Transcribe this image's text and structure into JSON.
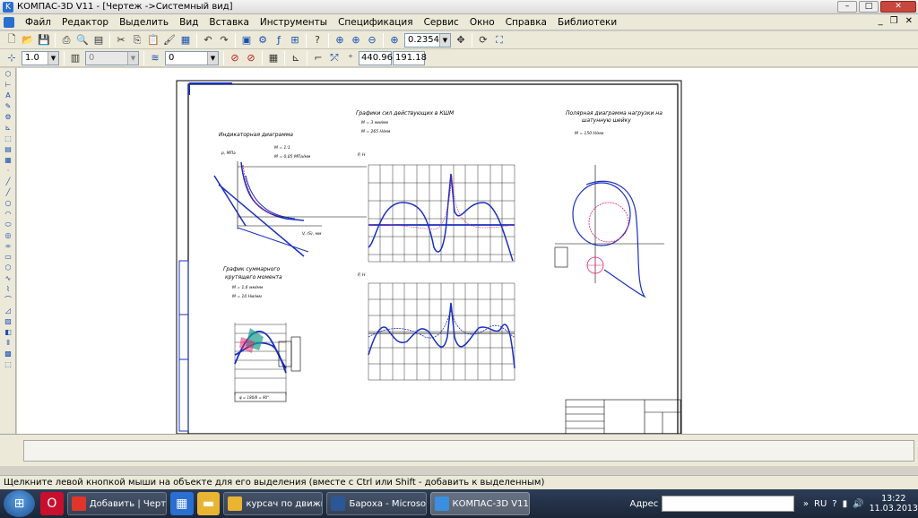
{
  "window": {
    "title": "КОМПАС-3D V11 - [Чертеж ->Системный вид]"
  },
  "menu": [
    "Файл",
    "Редактор",
    "Выделить",
    "Вид",
    "Вставка",
    "Инструменты",
    "Спецификация",
    "Сервис",
    "Окно",
    "Справка",
    "Библиотеки"
  ],
  "toolbar": {
    "zoom": "0.2354",
    "line_scale": "1.0",
    "layer_disabled": "0",
    "view": "0",
    "coord_x": "440.96",
    "coord_y": "191.18"
  },
  "drawing": {
    "indicator_title": "Индикаторная диаграмма",
    "indicator_p": "p, МПа",
    "indicator_m1": "M  = 1:1",
    "indicator_m2": "M  = 0,05 МПа/мм",
    "indicator_v": "V, (S), мм",
    "forces_title": "Графики сил  действующих в КШМ",
    "forces_m1": "M  = 3 мм/мм",
    "forces_m2": "M  = 265 Н/мм",
    "forces_p": "P, Н",
    "forces_p2": "P, Н",
    "polar_title": "Полярная диаграмма нагрузки на",
    "polar_title2": "шатунную шейку",
    "polar_m": "M  = 150 Н/мм",
    "torque_title": "График суммарного",
    "torque_title2": "крутящего момента",
    "torque_m1": "M  = 1,6 мм/мм",
    "torque_m2": "M  = 10 Нм/мм",
    "torque_bottom": "φ = 180/8 = 90°"
  },
  "status": {
    "hint": "Щелкните левой кнопкой мыши на объекте для его выделения (вместе с Ctrl или Shift - добавить к выделенным)"
  },
  "taskbar": {
    "items": [
      "Добавить | Черте...",
      "курсач по движк...",
      "Бароха - Microso...",
      "КОМПАС-3D V11..."
    ],
    "address_label": "Адрес",
    "lang": "RU",
    "time": "13:22",
    "date": "11.03.2013"
  }
}
